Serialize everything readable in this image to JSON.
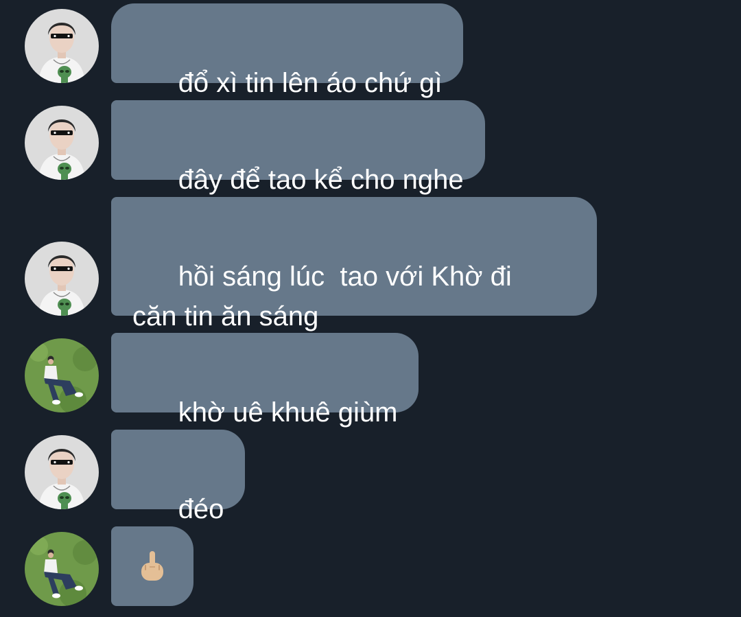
{
  "theme": {
    "background": "#18202a",
    "bubble_color": "#66788a",
    "text_color": "#ffffff"
  },
  "messages": [
    {
      "sender": "avatar-a",
      "text": "đổ xì tin lên áo chứ gì"
    },
    {
      "sender": "avatar-a",
      "text": "đây để tao kể cho nghe"
    },
    {
      "sender": "avatar-a",
      "text": "hồi sáng lúc  tao với Khờ đi\ncăn tin ăn sáng"
    },
    {
      "sender": "avatar-b",
      "text": "khờ uê khuê giùm"
    },
    {
      "sender": "avatar-a",
      "text": "đéo"
    },
    {
      "sender": "avatar-b",
      "icon": "middle-finger-emoji-icon"
    }
  ]
}
